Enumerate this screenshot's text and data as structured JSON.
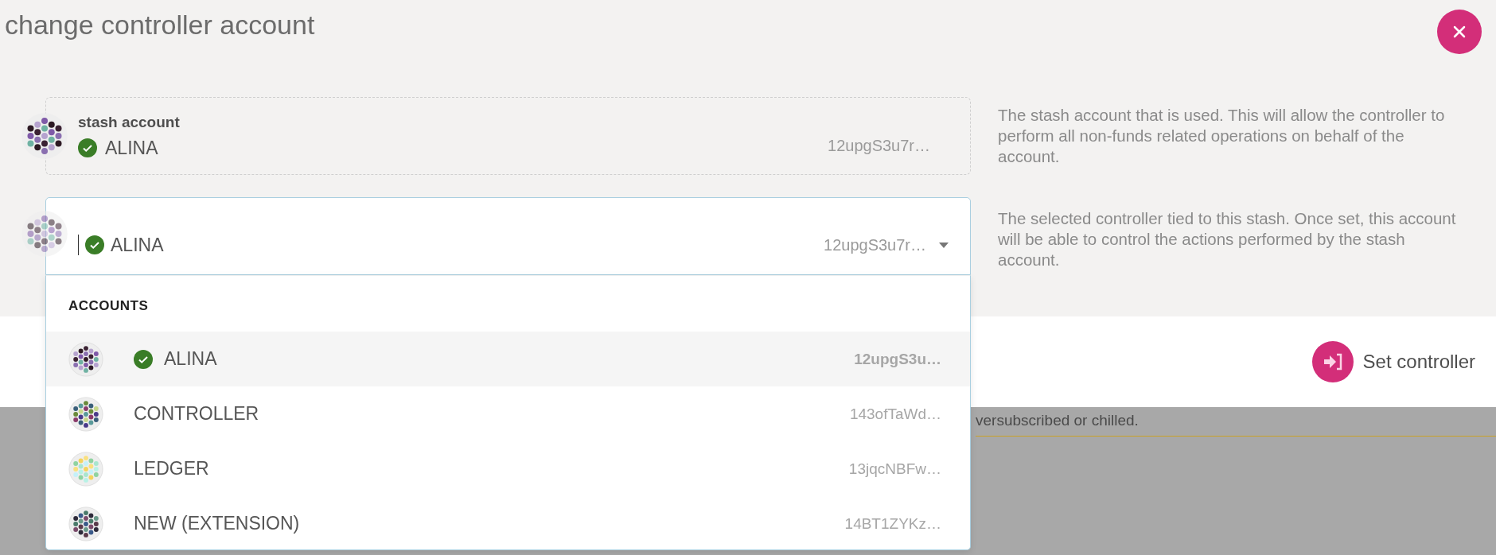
{
  "title": "change controller account",
  "stash": {
    "label": "stash account",
    "name": "ALINA",
    "verified": true,
    "address": "12upgS3u7r…",
    "help": "The stash account that is used. This will allow the controller to perform all non-funds related operations on behalf of the account."
  },
  "controller": {
    "name": "ALINA",
    "verified": true,
    "address": "12upgS3u7r…",
    "expanded": true,
    "help": "The selected controller tied to this stash. Once set, this account will be able to control the actions performed by the stash account."
  },
  "menu": {
    "heading": "ACCOUNTS",
    "items": [
      {
        "name": "ALINA",
        "address": "12upgS3u…",
        "verified": true,
        "selected": true
      },
      {
        "name": "CONTROLLER",
        "address": "143ofTaWd…",
        "verified": false,
        "selected": false
      },
      {
        "name": "LEDGER",
        "address": "13jqcNBFw…",
        "verified": false,
        "selected": false
      },
      {
        "name": "NEW (EXTENSION)",
        "address": "14BT1ZYKz…",
        "verified": false,
        "selected": false
      }
    ]
  },
  "action": {
    "label": "Set controller"
  },
  "background_text": "versubscribed or chilled."
}
